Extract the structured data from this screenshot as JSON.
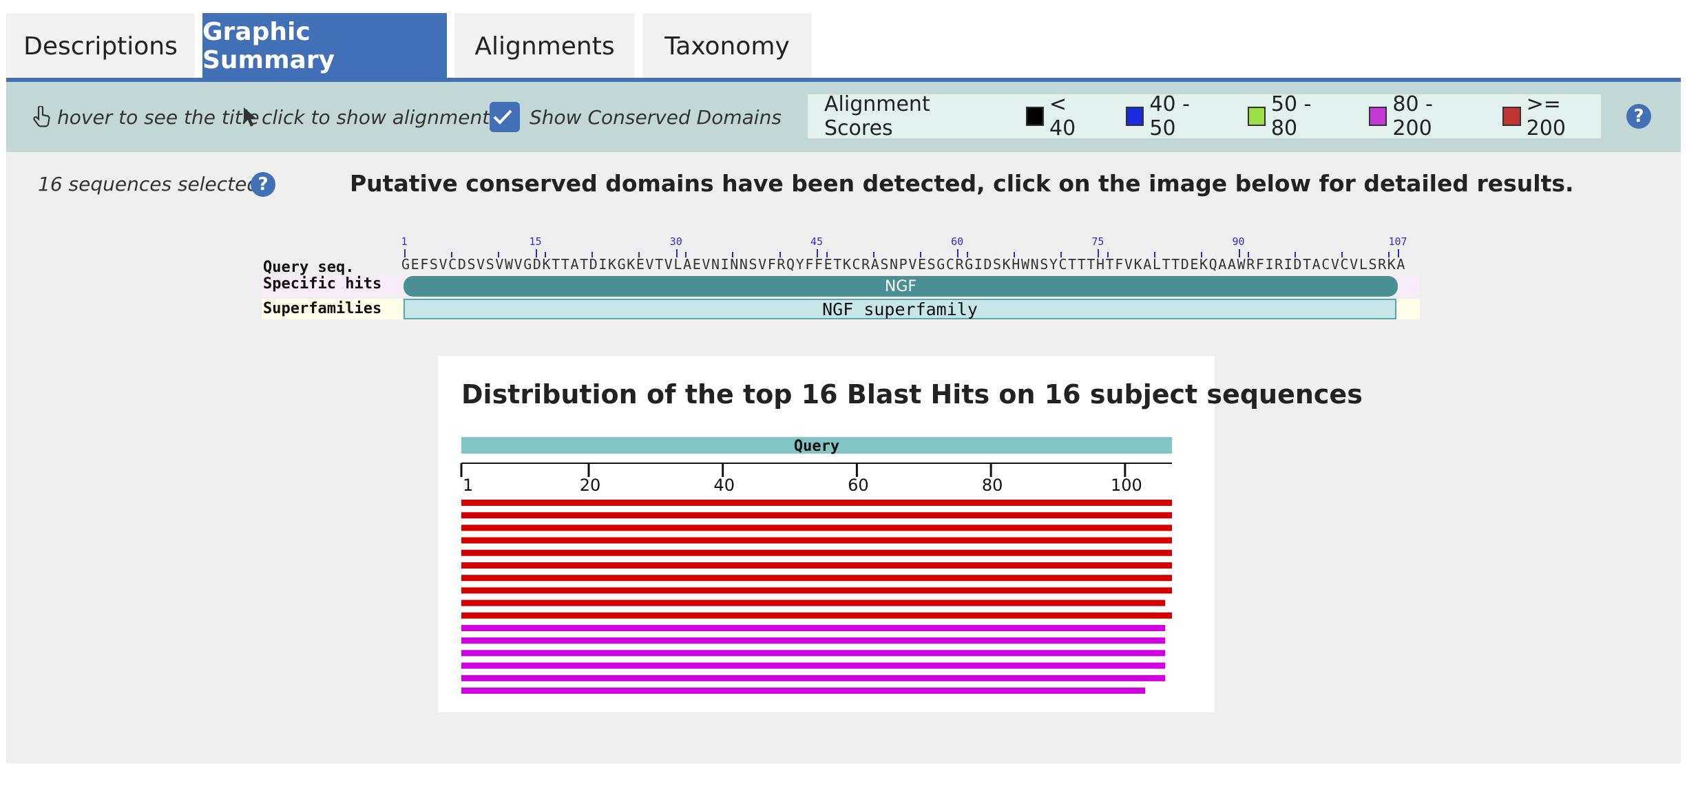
{
  "tabs": [
    {
      "label": "Descriptions",
      "active": false
    },
    {
      "label": "Graphic Summary",
      "active": true
    },
    {
      "label": "Alignments",
      "active": false
    },
    {
      "label": "Taxonomy",
      "active": false
    }
  ],
  "toolbar": {
    "hover_hint": "hover to see the title",
    "click_hint": "click to show alignments",
    "show_cd_label": "Show Conserved Domains",
    "show_cd_checked": true,
    "legend_title": "Alignment Scores",
    "legend": [
      {
        "label": "< 40",
        "color": "#000000"
      },
      {
        "label": "40 - 50",
        "color": "#1a2be0"
      },
      {
        "label": "50 - 80",
        "color": "#9be04a"
      },
      {
        "label": "80 - 200",
        "color": "#c43ad8"
      },
      {
        "label": ">= 200",
        "color": "#c23430"
      }
    ],
    "help_icon": "?"
  },
  "main": {
    "selected_text": "16 sequences selected",
    "help_icon": "?",
    "notice": "Putative conserved domains have been detected, click on the image below for detailed results."
  },
  "cd_graphic": {
    "query_label": "Query seq.",
    "specific_label": "Specific hits",
    "super_label": "Superfamilies",
    "ruler_numbers": [
      "1",
      "15",
      "30",
      "45",
      "60",
      "75",
      "90",
      "107"
    ],
    "sequence": "GEFSVCDSVSVWVGDKTTATDIKGKEVTVLAEVNINNSVFRQYFFETKCRASNPVESGCRGIDSKHWNSYCTTTHTFVKALTTDEKQAAWRFIRIDTACVCVLSRKA",
    "specific_hit": "NGF",
    "superfamily": "NGF superfamily",
    "colors": {
      "specific": "#4a8f91",
      "superfamily": "#c7e6e8"
    }
  },
  "distribution": {
    "title": "Distribution of the top 16 Blast Hits on 16 subject sequences",
    "query_label": "Query",
    "axis_ticks": [
      "1",
      "20",
      "40",
      "60",
      "80",
      "100"
    ],
    "query_length": 107,
    "colors": {
      "query": "#82c6c4",
      "red": "#d40000",
      "magenta": "#d100e0"
    },
    "hits": [
      {
        "start": 1,
        "end": 107,
        "color": "red"
      },
      {
        "start": 1,
        "end": 107,
        "color": "red"
      },
      {
        "start": 1,
        "end": 107,
        "color": "red"
      },
      {
        "start": 1,
        "end": 107,
        "color": "red"
      },
      {
        "start": 1,
        "end": 107,
        "color": "red"
      },
      {
        "start": 1,
        "end": 107,
        "color": "red"
      },
      {
        "start": 1,
        "end": 107,
        "color": "red"
      },
      {
        "start": 1,
        "end": 107,
        "color": "red"
      },
      {
        "start": 1,
        "end": 106,
        "color": "red"
      },
      {
        "start": 1,
        "end": 107,
        "color": "red"
      },
      {
        "start": 1,
        "end": 106,
        "color": "magenta"
      },
      {
        "start": 1,
        "end": 106,
        "color": "magenta"
      },
      {
        "start": 1,
        "end": 106,
        "color": "magenta"
      },
      {
        "start": 1,
        "end": 106,
        "color": "magenta"
      },
      {
        "start": 1,
        "end": 106,
        "color": "magenta"
      },
      {
        "start": 1,
        "end": 103,
        "color": "magenta"
      }
    ]
  }
}
